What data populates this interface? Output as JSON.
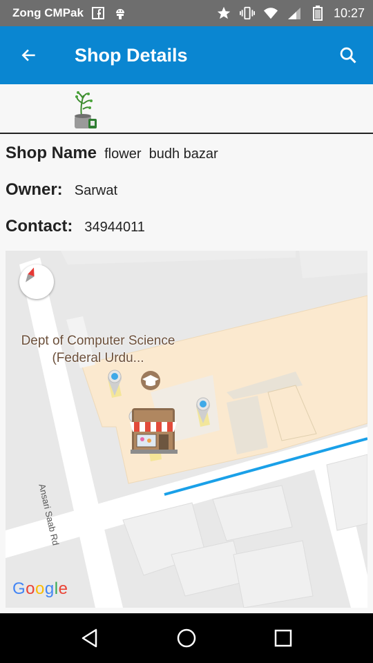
{
  "status_bar": {
    "carrier": "Zong CMPak",
    "time": "10:27",
    "icons": [
      "facebook-icon",
      "android-icon",
      "star-icon",
      "vibrate-icon",
      "wifi-icon",
      "signal-icon",
      "battery-icon"
    ]
  },
  "app_bar": {
    "title": "Shop Details",
    "back_icon": "arrow-back-icon",
    "search_icon": "search-icon"
  },
  "shop": {
    "name_label": "Shop Name",
    "name_value": "flower  budh bazar",
    "owner_label": "Owner:",
    "owner_value": "Sarwat",
    "contact_label": "Contact:",
    "contact_value": "34944011"
  },
  "map": {
    "place_label": "Dept of Computer Science (Federal Urdu...",
    "road_label": "Ansari Saab Rd",
    "attribution": "Google",
    "colors": {
      "building": "#fbe9cf",
      "road": "#ffffff",
      "route": "#1aa0e8",
      "ground": "#e8e8e8"
    }
  },
  "nav_bar": {
    "icons": [
      "back-triangle-icon",
      "home-circle-icon",
      "recents-square-icon"
    ]
  }
}
